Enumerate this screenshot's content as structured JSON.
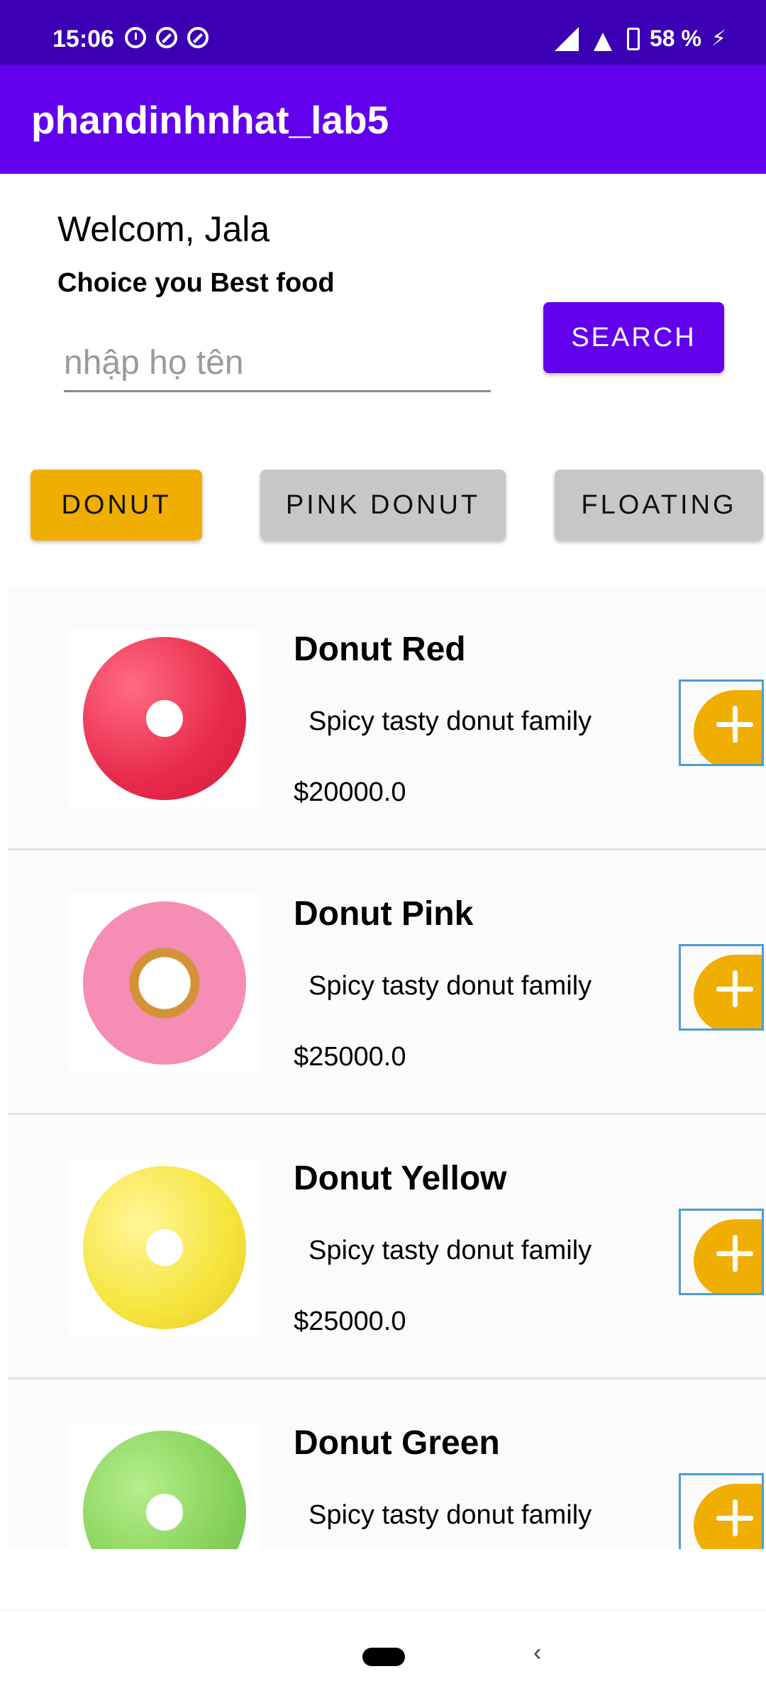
{
  "status_bar": {
    "time": "15:06",
    "battery_text": "58 %"
  },
  "app_bar": {
    "title": "phandinhnhat_lab5"
  },
  "header": {
    "welcome": "Welcom, Jala",
    "subtitle": "Choice you Best food",
    "search_placeholder": "nhập họ tên",
    "search_value": "",
    "search_button": "SEARCH"
  },
  "categories": [
    {
      "label": "DONUT",
      "active": true
    },
    {
      "label": "PINK DONUT",
      "active": false
    },
    {
      "label": "FLOATING",
      "active": false
    }
  ],
  "products": [
    {
      "name": "Donut Red",
      "description": "Spicy tasty donut family",
      "price": "$20000.0",
      "icon": "red-donut-image",
      "color": "#ec3b5a"
    },
    {
      "name": "Donut Pink",
      "description": "Spicy tasty donut family",
      "price": "$25000.0",
      "icon": "pink-donut-image",
      "color": "#f58db4"
    },
    {
      "name": "Donut Yellow",
      "description": "Spicy tasty donut family",
      "price": "$25000.0",
      "icon": "yellow-donut-image",
      "color": "#f7e84a"
    },
    {
      "name": "Donut Green",
      "description": "Spicy tasty donut family",
      "price": "",
      "icon": "green-donut-image",
      "color": "#93d86a"
    }
  ],
  "colors": {
    "status_bar": "#3b00b3",
    "primary": "#6200ee",
    "accent": "#f0ae00",
    "chip_inactive": "#c7c7c7"
  }
}
